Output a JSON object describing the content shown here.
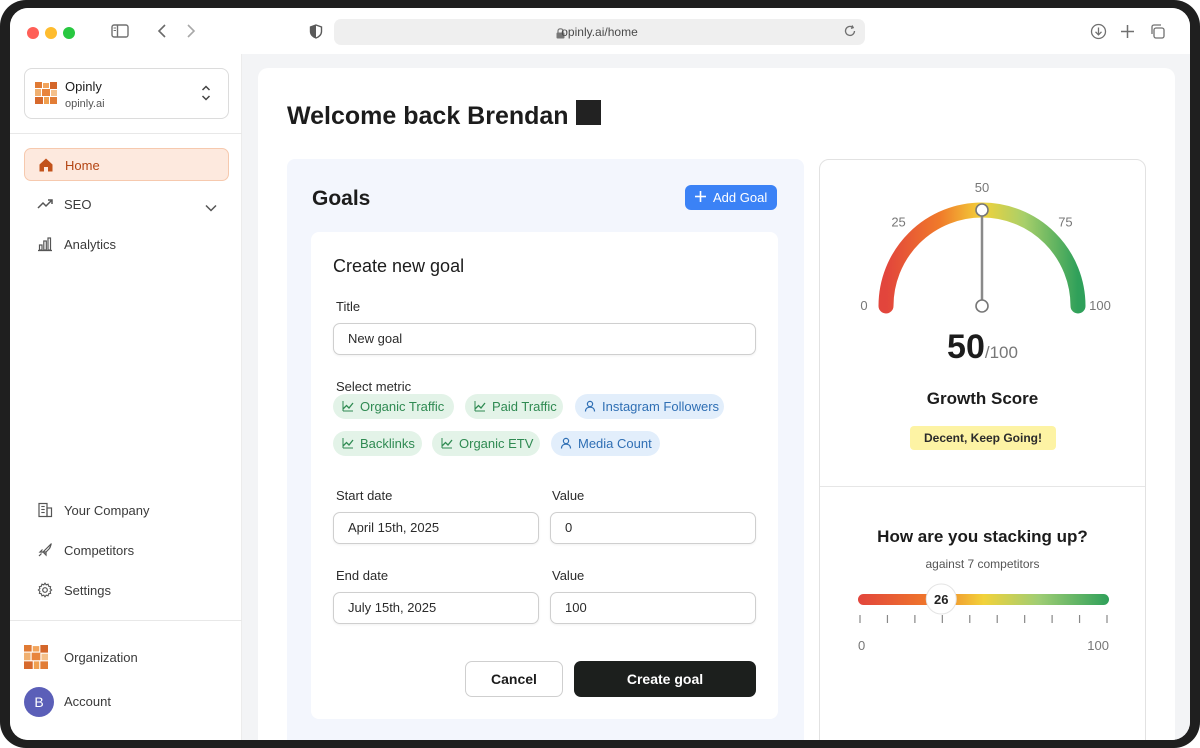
{
  "browser": {
    "url": "opinly.ai/home"
  },
  "sidebar": {
    "org": {
      "name": "Opinly",
      "domain": "opinly.ai"
    },
    "nav": [
      {
        "label": "Home",
        "icon": "home-icon",
        "active": true
      },
      {
        "label": "SEO",
        "icon": "trending-up-icon",
        "active": false
      },
      {
        "label": "Analytics",
        "icon": "bar-chart-icon",
        "active": false
      }
    ],
    "bottom_nav": [
      {
        "label": "Your Company",
        "icon": "building-icon"
      },
      {
        "label": "Competitors",
        "icon": "rocket-icon"
      },
      {
        "label": "Settings",
        "icon": "gear-icon"
      }
    ],
    "organization_label": "Organization",
    "account_label": "Account",
    "account_initial": "B"
  },
  "main": {
    "welcome": "Welcome back Brendan",
    "goals": {
      "title": "Goals",
      "add_label": "Add Goal",
      "form": {
        "title": "Create new goal",
        "title_label": "Title",
        "title_value": "New goal",
        "metric_label": "Select metric",
        "metrics": [
          {
            "label": "Organic Traffic",
            "kind": "chart"
          },
          {
            "label": "Paid Traffic",
            "kind": "chart"
          },
          {
            "label": "Instagram Followers",
            "kind": "user"
          },
          {
            "label": "Backlinks",
            "kind": "chart"
          },
          {
            "label": "Organic ETV",
            "kind": "chart"
          },
          {
            "label": "Media Count",
            "kind": "user"
          }
        ],
        "start_label": "Start date",
        "start_value": "April 15th, 2025",
        "start_value_label": "Value",
        "start_amount": "0",
        "end_label": "End date",
        "end_value": "July 15th, 2025",
        "end_value_label": "Value",
        "end_amount": "100",
        "cancel": "Cancel",
        "create": "Create goal"
      }
    },
    "score": {
      "value": 50,
      "value_text": "50",
      "max_text": "/100",
      "ticks": [
        "0",
        "25",
        "50",
        "75",
        "100"
      ],
      "label": "Growth Score",
      "badge": "Decent, Keep Going!"
    },
    "stacking": {
      "title": "How are you stacking up?",
      "subtitle": "against 7 competitors",
      "value": 26,
      "value_text": "26",
      "min_text": "0",
      "max_text": "100"
    }
  },
  "colors": {
    "accent": "#3b82f6",
    "nav_active_bg": "#fde9de",
    "nav_active_text": "#b44513",
    "chip_green": "#2f8a52",
    "chip_blue": "#2f6fb4",
    "badge_bg": "#fdf3a4"
  }
}
